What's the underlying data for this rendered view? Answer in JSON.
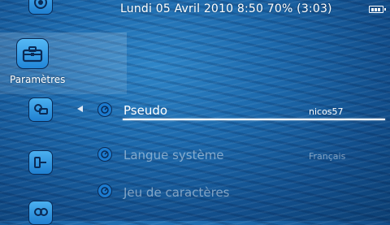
{
  "status_bar": {
    "datetime_text": "Lundi 05 Avril 2010 8:50 70% (3:03)",
    "battery_level": 0.7
  },
  "categories": {
    "selected_label": "Paramètres",
    "icons": [
      "game-icon",
      "toolbox-icon",
      "network-icon",
      "network-icon",
      "network-icon"
    ]
  },
  "settings": {
    "rows": [
      {
        "label": "Pseudo",
        "value": "nicos57",
        "selected": true,
        "icon": "settings-row-icon"
      },
      {
        "label": "Langue système",
        "value": "Français",
        "selected": false,
        "icon": "settings-row-icon"
      },
      {
        "label": "Jeu de caractères",
        "value": "",
        "selected": false,
        "icon": "settings-row-icon"
      }
    ]
  },
  "colors": {
    "accent": "#1c7bcf",
    "background": "#1d6aad"
  }
}
